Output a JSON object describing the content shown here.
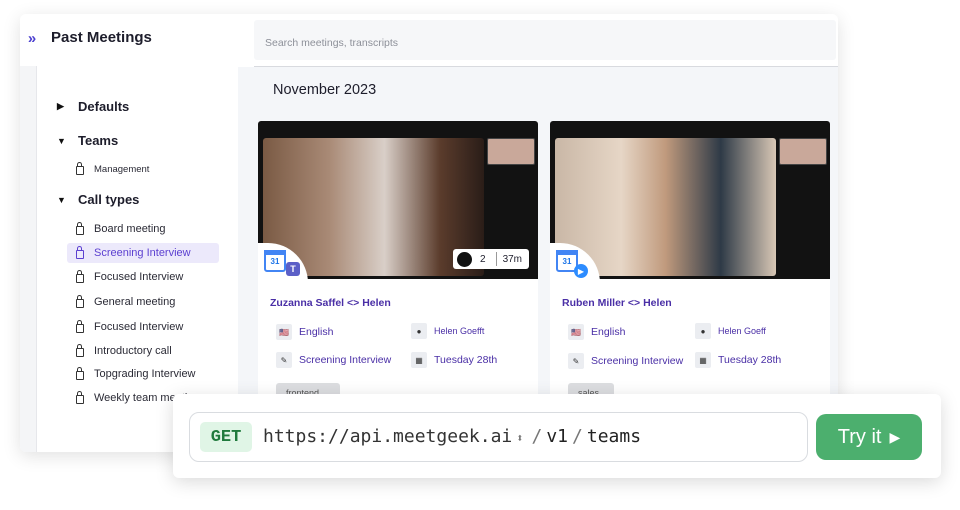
{
  "header": {
    "title": "Past Meetings",
    "search_placeholder": "Search meetings, transcripts"
  },
  "sidebar": {
    "sections": [
      {
        "label": "Defaults",
        "expanded": false
      },
      {
        "label": "Teams",
        "expanded": true
      },
      {
        "label": "Call types",
        "expanded": true
      }
    ],
    "teams_items": [
      "Management"
    ],
    "call_types": [
      "Board meeting",
      "Screening Interview",
      "Focused Interview",
      "General meeting",
      "Focused Interview",
      "Introductory call",
      "Topgrading Interview",
      "Weekly team meeting"
    ],
    "active_item": "Screening Interview"
  },
  "main": {
    "month": "November 2023",
    "cards": [
      {
        "title": "Zuzanna Saffel <> Helen",
        "participants": "2",
        "duration": "37m",
        "language": "English",
        "host": "Helen Goefft",
        "call_type": "Screening Interview",
        "date": "Tuesday 28th",
        "tag": "frontend",
        "calendar_day": "31",
        "platform_icon": "teams-icon"
      },
      {
        "title": "Ruben Miller <> Helen",
        "language": "English",
        "host": "Helen Goeff",
        "call_type": "Screening Interview",
        "date": "Tuesday 28th",
        "tag": "sales",
        "calendar_day": "31",
        "platform_icon": "zoom-icon"
      }
    ]
  },
  "api": {
    "method": "GET",
    "base_url": "https://api.meetgeek.ai",
    "seg1": "v1",
    "seg2": "teams",
    "sep": "/",
    "button_label": "Try it"
  },
  "colors": {
    "accent": "#5b3fd0",
    "try_green": "#4caf6e",
    "get_bg": "#e0f5e6"
  }
}
